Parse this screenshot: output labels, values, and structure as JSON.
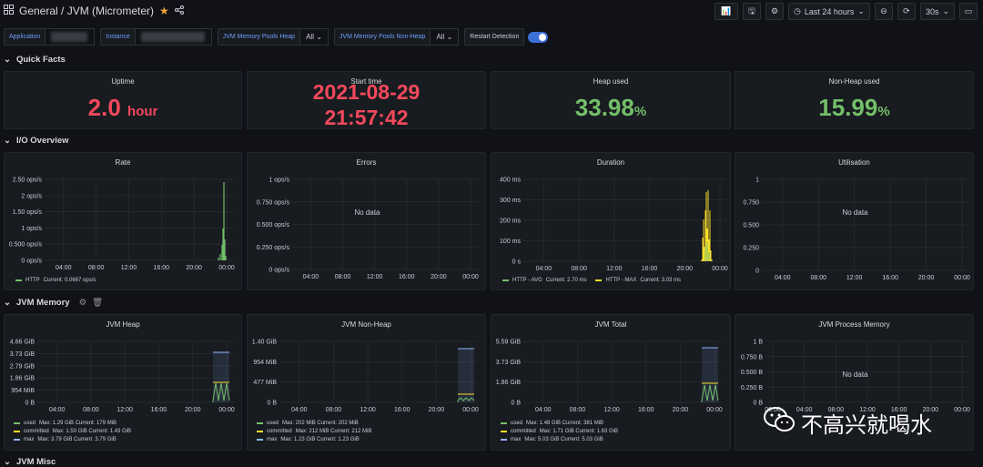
{
  "header": {
    "title": "General / JVM (Micrometer)",
    "time_range": "Last 24 hours",
    "refresh": "30s"
  },
  "variables": [
    {
      "label": "Application"
    },
    {
      "label": "Instance"
    },
    {
      "label": "JVM Memory Pools Heap",
      "value": "All"
    },
    {
      "label": "JVM Memory Pools Non-Heap",
      "value": "All"
    },
    {
      "label": "Restart Detection"
    }
  ],
  "rows": {
    "quick_facts": "Quick Facts",
    "io": "I/O Overview",
    "jvm_memory": "JVM Memory",
    "jvm_misc": "JVM Misc"
  },
  "quick_facts": {
    "uptime": {
      "title": "Uptime",
      "value": "2.0",
      "unit": "hour"
    },
    "start_time": {
      "title": "Start time",
      "line1": "2021-08-29",
      "line2": "21:57:42"
    },
    "heap_used": {
      "title": "Heap used",
      "value": "33.98",
      "unit": "%"
    },
    "nonheap_used": {
      "title": "Non-Heap used",
      "value": "15.99",
      "unit": "%"
    }
  },
  "colors": {
    "green": "#73bf69",
    "red": "#f2495c",
    "yellow": "#fade2a",
    "blue": "#5794f2",
    "cyan": "#8ab8ff"
  },
  "charts": {
    "rate": {
      "title": "Rate",
      "yticks": [
        "2.50 ops/s",
        "2 ops/s",
        "1.50 ops/s",
        "1 ops/s",
        "0.500 ops/s",
        "0 ops/s"
      ],
      "xticks": [
        "04:00",
        "08:00",
        "12:00",
        "16:00",
        "20:00",
        "00:00"
      ],
      "legend": [
        {
          "name": "HTTP",
          "text": "Current: 0.0667 ops/s",
          "color": "#73bf69"
        }
      ]
    },
    "errors": {
      "title": "Errors",
      "nodata": "No data",
      "yticks": [
        "1 ops/s",
        "0.750 ops/s",
        "0.500 ops/s",
        "0.250 ops/s",
        "0 ops/s"
      ],
      "xticks": [
        "04:00",
        "08:00",
        "12:00",
        "16:00",
        "20:00",
        "00:00"
      ]
    },
    "duration": {
      "title": "Duration",
      "yticks": [
        "400 ms",
        "300 ms",
        "200 ms",
        "100 ms",
        "0 s"
      ],
      "xticks": [
        "04:00",
        "08:00",
        "12:00",
        "16:00",
        "20:00",
        "00:00"
      ],
      "legend": [
        {
          "name": "HTTP - AVG",
          "text": "Current: 2.70 ms",
          "color": "#73bf69"
        },
        {
          "name": "HTTP - MAX",
          "text": "Current: 3.03 ms",
          "color": "#fade2a"
        }
      ]
    },
    "utilisation": {
      "title": "Utilisation",
      "nodata": "No data",
      "yticks": [
        "1",
        "0.750",
        "0.500",
        "0.250",
        "0"
      ],
      "xticks": [
        "04:00",
        "08:00",
        "12:00",
        "16:00",
        "20:00",
        "00:00"
      ]
    },
    "jvm_heap": {
      "title": "JVM Heap",
      "yticks": [
        "4.66 GiB",
        "3.73 GiB",
        "2.79 GiB",
        "1.86 GiB",
        "954 MiB",
        "0 B"
      ],
      "xticks": [
        "04:00",
        "08:00",
        "12:00",
        "16:00",
        "20:00",
        "00:00"
      ],
      "legend": [
        {
          "name": "used",
          "text": "Max: 1.29 GiB  Current: 179 MiB",
          "color": "#73bf69"
        },
        {
          "name": "committed",
          "text": "Max: 1.50 GiB  Current: 1.43 GiB",
          "color": "#fade2a"
        },
        {
          "name": "max",
          "text": "Max: 3.79 GiB  Current: 3.79 GiB",
          "color": "#8ab8ff"
        }
      ]
    },
    "jvm_nonheap": {
      "title": "JVM Non-Heap",
      "yticks": [
        "1.40 GiB",
        "954 MiB",
        "477 MiB",
        "0 B"
      ],
      "xticks": [
        "04:00",
        "08:00",
        "12:00",
        "16:00",
        "20:00",
        "00:00"
      ],
      "legend": [
        {
          "name": "used",
          "text": "Max: 202 MiB  Current: 202 MiB",
          "color": "#73bf69"
        },
        {
          "name": "committed",
          "text": "Max: 212 MiB  Current: 212 MiB",
          "color": "#fade2a"
        },
        {
          "name": "max",
          "text": "Max: 1.23 GiB  Current: 1.23 GiB",
          "color": "#8ab8ff"
        }
      ]
    },
    "jvm_total": {
      "title": "JVM Total",
      "yticks": [
        "5.59 GiB",
        "3.73 GiB",
        "1.86 GiB",
        "0 B"
      ],
      "xticks": [
        "04:00",
        "08:00",
        "12:00",
        "16:00",
        "20:00",
        "00:00"
      ],
      "legend": [
        {
          "name": "used",
          "text": "Max: 1.48 GiB  Current: 381 MiB",
          "color": "#73bf69"
        },
        {
          "name": "committed",
          "text": "Max: 1.71 GiB  Current: 1.63 GiB",
          "color": "#fade2a"
        },
        {
          "name": "max",
          "text": "Max: 5.03 GiB  Current: 5.03 GiB",
          "color": "#8ab8ff"
        }
      ]
    },
    "jvm_process": {
      "title": "JVM Process Memory",
      "nodata": "No data",
      "yticks": [
        "1 B",
        "0.750 B",
        "0.500 B",
        "0.250 B",
        "0 B"
      ],
      "xticks": [
        "00:00",
        "04:00",
        "08:00",
        "12:00",
        "16:00",
        "20:00",
        "00:00"
      ]
    }
  },
  "watermark": "不高兴就喝水"
}
